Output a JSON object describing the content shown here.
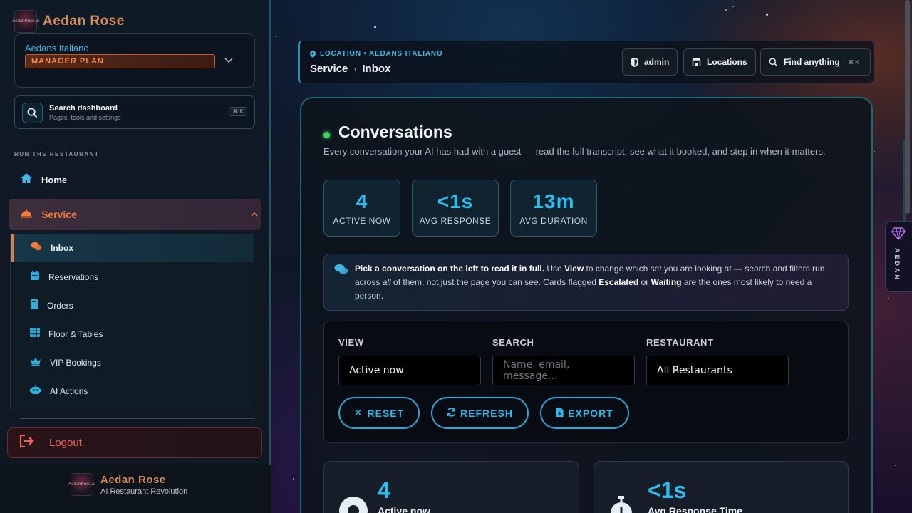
{
  "sidebar": {
    "brand": "Aedan Rose",
    "logo_text": "AedanRose.ai",
    "location": {
      "name": "Aedans Italiano",
      "plan": "MANAGER PLAN"
    },
    "search": {
      "title": "Search dashboard",
      "subtitle": "Pages, tools and settings",
      "shortcut": "⌘ K"
    },
    "section_label": "RUN THE RESTAURANT",
    "home_label": "Home",
    "service_label": "Service",
    "sub_items": [
      {
        "label": "Inbox",
        "icon": "chat-bubbles-icon",
        "active": true
      },
      {
        "label": "Reservations",
        "icon": "calendar-icon"
      },
      {
        "label": "Orders",
        "icon": "receipt-icon"
      },
      {
        "label": "Floor & Tables",
        "icon": "grid-icon"
      },
      {
        "label": "VIP Bookings",
        "icon": "crown-icon"
      },
      {
        "label": "AI Actions",
        "icon": "robot-icon"
      }
    ],
    "logout_label": "Logout",
    "footer": {
      "name": "Aedan Rose",
      "tagline": "AI Restaurant Revolution"
    }
  },
  "header": {
    "location_line": "LOCATION • AEDANS ITALIANO",
    "breadcrumb": [
      "Service",
      "Inbox"
    ],
    "buttons": {
      "admin": "admin",
      "locations": "Locations",
      "find": "Find anything",
      "find_shortcut": "⌘ K"
    }
  },
  "main": {
    "title": "Conversations",
    "description": "Every conversation your AI has had with a guest — read the full transcript, see what it booked, and step in when it matters.",
    "stats": [
      {
        "value": "4",
        "label": "ACTIVE NOW"
      },
      {
        "value": "<1s",
        "label": "AVG RESPONSE"
      },
      {
        "value": "13m",
        "label": "AVG DURATION"
      }
    ],
    "info": {
      "p1_bold": "Pick a conversation on the left to read it in full.",
      "p2": " Use ",
      "p3_bold": "View",
      "p4": " to change which set you are looking at — search and filters run across ",
      "p5_italic": "all",
      "p6": " of them, not just the page you can see. Cards flagged ",
      "p7_bold": "Escalated",
      "p8": " or ",
      "p9_bold": "Waiting",
      "p10": " are the ones most likely to need a person."
    },
    "filters": {
      "view_label": "VIEW",
      "view_value": "Active now",
      "search_label": "SEARCH",
      "search_placeholder": "Name, email, message...",
      "restaurant_label": "RESTAURANT",
      "restaurant_value": "All Restaurants"
    },
    "actions": {
      "reset": "RESET",
      "refresh": "REFRESH",
      "export": "EXPORT"
    },
    "cards": [
      {
        "value": "4",
        "label": "Active now"
      },
      {
        "value": "<1s",
        "label": "Avg Response Time"
      }
    ]
  },
  "side_tab": {
    "label": "AEDAN"
  },
  "colors": {
    "accent": "#28c0f0",
    "brand": "#d38a5c",
    "service": "#f07a3a",
    "danger": "#f06060"
  }
}
